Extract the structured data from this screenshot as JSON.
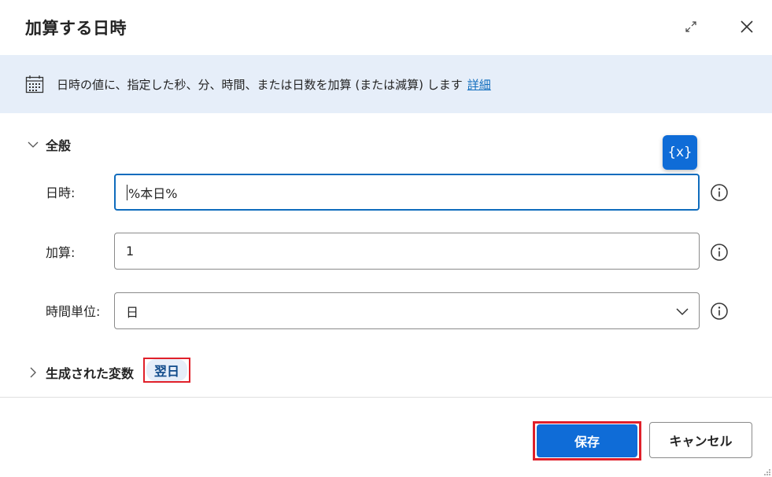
{
  "dialog": {
    "title": "加算する日時"
  },
  "info": {
    "description": "日時の値に、指定した秒、分、時間、または日数を加算 (または減算) します",
    "more_link": "詳細"
  },
  "general_section": {
    "label": "全般",
    "variable_button": "{x}"
  },
  "fields": {
    "datetime": {
      "label": "日時:",
      "value": "%本日%"
    },
    "add": {
      "label": "加算:",
      "value": "1"
    },
    "time_unit": {
      "label": "時間単位:",
      "value": "日"
    }
  },
  "generated_section": {
    "label": "生成された変数",
    "variable": "翌日"
  },
  "footer": {
    "save": "保存",
    "cancel": "キャンセル"
  },
  "colors": {
    "accent": "#0f6cd7",
    "info_bar": "#e6eef9",
    "highlight": "#e0202a"
  }
}
